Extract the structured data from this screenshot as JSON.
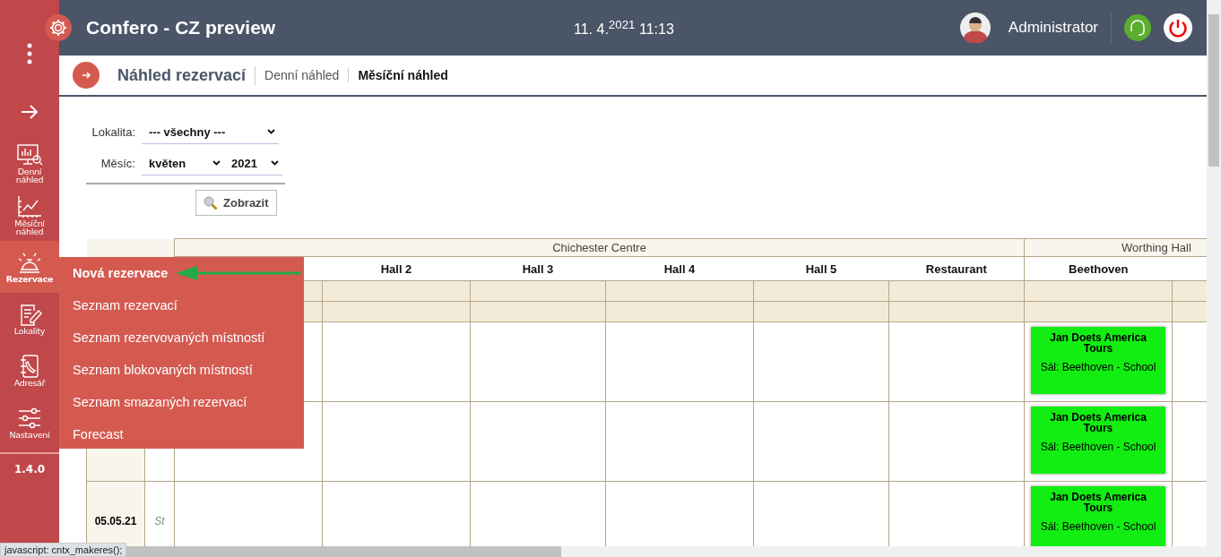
{
  "header": {
    "title": "Confero - CZ preview",
    "datetime": "11. 4.$^{2021}$ 11:13",
    "user": "Administrator"
  },
  "sidebar": {
    "items": [
      {
        "label": "Denní náhled",
        "selected": false
      },
      {
        "label": "Měsíční náhled",
        "selected": false
      },
      {
        "label": "Rezervace",
        "selected": true
      },
      {
        "label": "Lokality",
        "selected": false
      },
      {
        "label": "Adresář",
        "selected": false
      },
      {
        "label": "Nastavení",
        "selected": false
      }
    ],
    "version": "1.4.0"
  },
  "page": {
    "title": "Náhled rezervací",
    "tabs": [
      {
        "label": "Denní náhled",
        "selected": false
      },
      {
        "label": "Měsíční náhled",
        "selected": true
      }
    ]
  },
  "filters": [
    {
      "label": "Lokalita:",
      "selects": [
        "--- všechny ---"
      ]
    },
    {
      "label": "Měsíc:",
      "selects": [
        "květen",
        "2021"
      ]
    }
  ],
  "show_button": "Zobrazit",
  "table": {
    "groups": [
      {
        "name": "Chichester Centre",
        "columns": [
          "Hall 2",
          "Hall 3",
          "Hall 4",
          "Hall 5",
          "Restaurant"
        ]
      },
      {
        "name": "Worthing Hall",
        "columns": [
          "Beethoven"
        ]
      }
    ],
    "rows": [
      {
        "booking": {
          "title": "Jan Doets America Tours",
          "detail": "Sál: Beethoven - School",
          "color": "#12ee12"
        }
      },
      {
        "booking": {
          "title": "Jan Doets America Tours",
          "detail": "Sál: Beethoven - School",
          "color": "#12ee12"
        }
      },
      {
        "date": "05.05.21",
        "day": "St",
        "booking": {
          "title": "Jan Doets America Tours",
          "detail": "Sál: Beethoven - School",
          "color": "#12ee12"
        }
      }
    ]
  },
  "menu": {
    "items": [
      {
        "label": "Nová rezervace",
        "selected": true
      },
      {
        "label": "Seznam rezervací",
        "selected": false
      },
      {
        "label": "Seznam rezervovaných místností",
        "selected": false
      },
      {
        "label": "Seznam blokovaných místností",
        "selected": false
      },
      {
        "label": "Seznam smazaných rezervací",
        "selected": false
      },
      {
        "label": "Forecast",
        "selected": false
      }
    ]
  },
  "status_link": "javascript: cntx_makeres();"
}
